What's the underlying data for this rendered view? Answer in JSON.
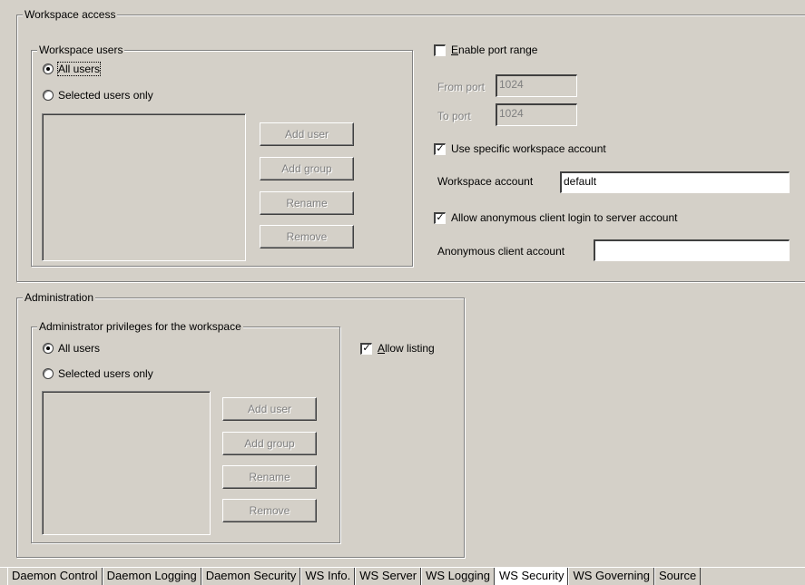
{
  "workspace_access": {
    "title": "Workspace access",
    "users_group": {
      "title": "Workspace users",
      "radio_all": "All users",
      "radio_selected": "Selected users only",
      "buttons": [
        "Add user",
        "Add group",
        "Rename",
        "Remove"
      ]
    },
    "enable_port_range": {
      "label": "Enable port range",
      "checked": false
    },
    "from_port": {
      "label": "From port",
      "value": "1024"
    },
    "to_port": {
      "label": "To port",
      "value": "1024"
    },
    "use_specific_account": {
      "label": "Use specific workspace account",
      "checked": true
    },
    "workspace_account": {
      "label": "Workspace account",
      "value": "default"
    },
    "allow_anonymous": {
      "label": "Allow anonymous client login to server account",
      "checked": true
    },
    "anonymous_account": {
      "label": "Anonymous client account",
      "value": ""
    }
  },
  "administration": {
    "title": "Administration",
    "privileges_group": {
      "title": "Administrator privileges for the workspace",
      "radio_all": "All users",
      "radio_selected": "Selected users only",
      "buttons": [
        "Add user",
        "Add group",
        "Rename",
        "Remove"
      ]
    },
    "allow_listing": {
      "label": "Allow listing",
      "checked": true
    }
  },
  "tabs": [
    {
      "label": "Daemon Control",
      "active": false
    },
    {
      "label": "Daemon Logging",
      "active": false
    },
    {
      "label": "Daemon Security",
      "active": false
    },
    {
      "label": "WS Info.",
      "active": false
    },
    {
      "label": "WS Server",
      "active": false
    },
    {
      "label": "WS Logging",
      "active": false
    },
    {
      "label": "WS Security",
      "active": true
    },
    {
      "label": "WS Governing",
      "active": false
    },
    {
      "label": "Source",
      "active": false
    }
  ],
  "checkmark_glyph": "✓"
}
